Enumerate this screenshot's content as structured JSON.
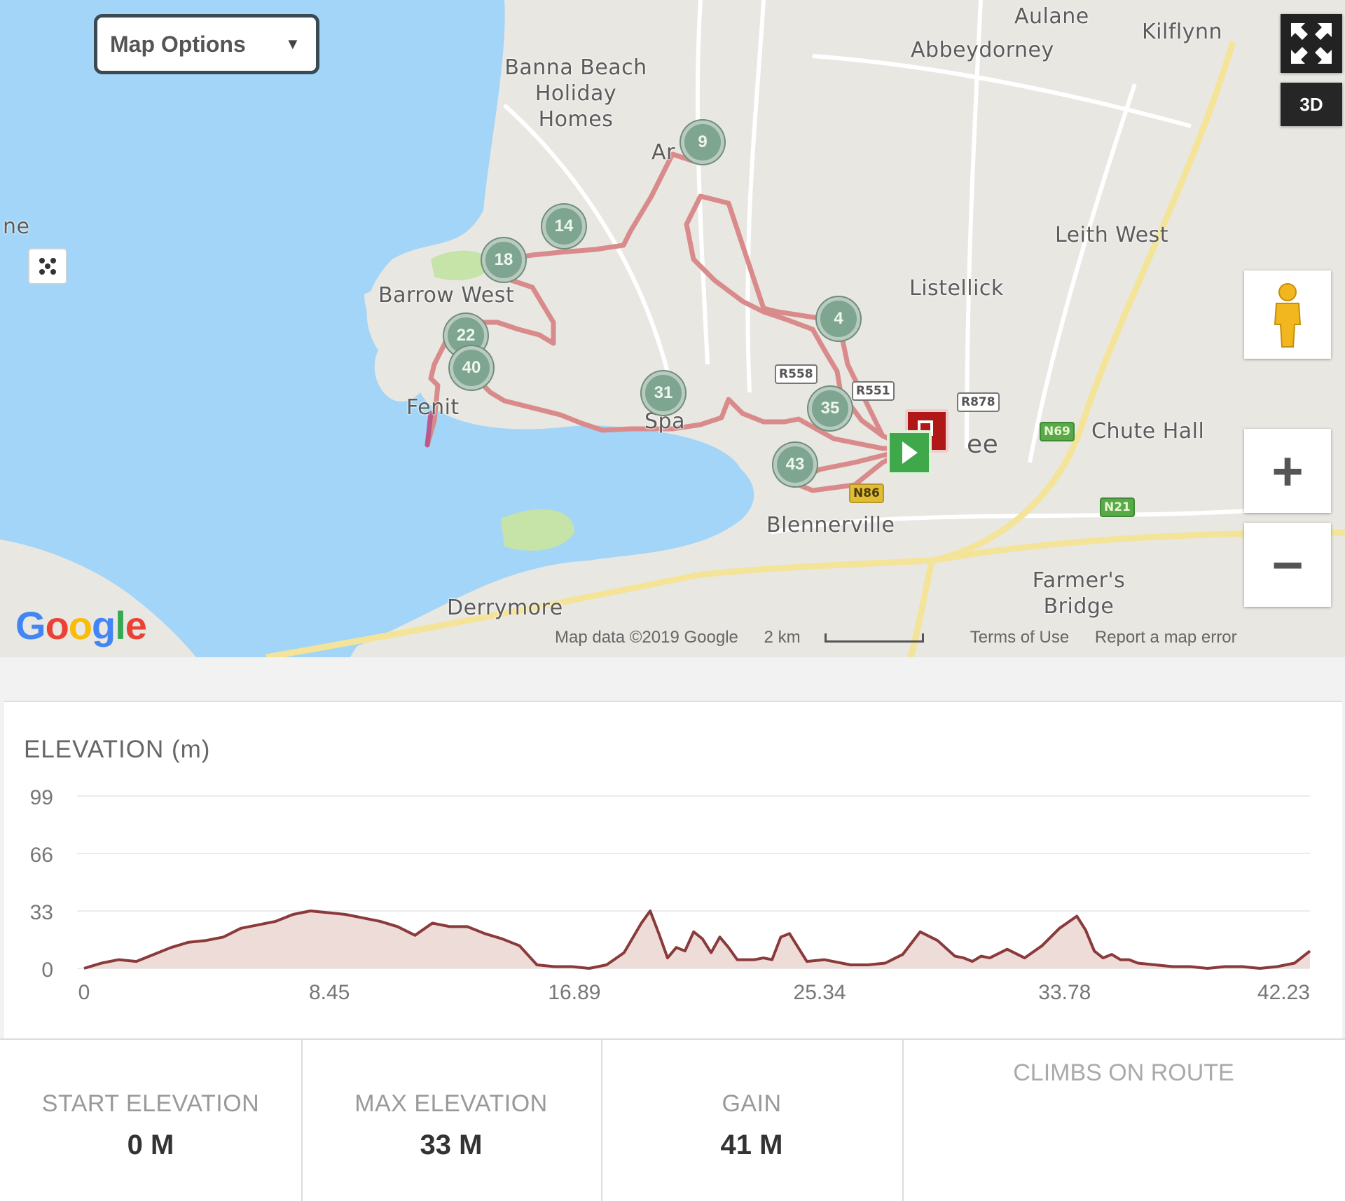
{
  "map": {
    "options_label": "Map Options",
    "view_3d_label": "3D",
    "places": [
      {
        "text": "Aulane"
      },
      {
        "text": "Kilflynn"
      },
      {
        "text": "Abbeydorney"
      },
      {
        "text": "Banna Beach Holiday Homes"
      },
      {
        "text": "Ar"
      },
      {
        "text": "Leith West"
      },
      {
        "text": "Listellick"
      },
      {
        "text": "Barrow West"
      },
      {
        "text": "Fenit"
      },
      {
        "text": "Spa"
      },
      {
        "text": "Chute Hall"
      },
      {
        "text": "Blennerville"
      },
      {
        "text": "Farmer's Bridge"
      },
      {
        "text": "Derrymore"
      },
      {
        "text": "ee"
      },
      {
        "text": "ne"
      }
    ],
    "road_badges": [
      "R558",
      "R551",
      "R878",
      "N69",
      "N21",
      "N86"
    ],
    "km_markers": [
      "9",
      "14",
      "18",
      "4",
      "22",
      "40",
      "31",
      "35",
      "43"
    ],
    "footer": {
      "map_data": "Map data ©2019 Google",
      "scale": "2 km",
      "terms": "Terms of Use",
      "report": "Report a map error"
    },
    "colors": {
      "water": "#a2d5f7",
      "land": "#e9e7e2",
      "route": "#d98b8b",
      "park": "#c6e3a8"
    }
  },
  "elevation": {
    "title": "ELEVATION (m)",
    "chart_data": {
      "type": "area",
      "title": "ELEVATION (m)",
      "xlabel": "",
      "ylabel": "",
      "ylim": [
        0,
        99
      ],
      "xlim": [
        0,
        42.23
      ],
      "y_ticks": [
        "0",
        "33",
        "66",
        "99"
      ],
      "x_ticks": [
        "0",
        "8.45",
        "16.89",
        "25.34",
        "33.78",
        "42.23"
      ],
      "grid": true,
      "x": [
        0,
        0.6,
        1.2,
        1.8,
        2.4,
        3.0,
        3.6,
        4.2,
        4.8,
        5.4,
        6.0,
        6.6,
        7.2,
        7.8,
        8.4,
        9.0,
        9.6,
        10.2,
        10.8,
        11.4,
        12.0,
        12.6,
        13.2,
        13.8,
        14.4,
        15.0,
        15.6,
        16.2,
        16.8,
        17.4,
        18.0,
        18.6,
        19.2,
        19.5,
        19.8,
        20.1,
        20.4,
        20.7,
        21.0,
        21.3,
        21.6,
        21.9,
        22.2,
        22.5,
        22.8,
        23.1,
        23.4,
        23.7,
        24.0,
        24.3,
        24.9,
        25.5,
        25.8,
        26.1,
        26.4,
        27.0,
        27.6,
        28.2,
        28.8,
        29.4,
        30.0,
        30.3,
        30.6,
        30.9,
        31.2,
        31.8,
        32.4,
        33.0,
        33.6,
        34.2,
        34.5,
        34.8,
        35.1,
        35.4,
        35.7,
        36.0,
        36.3,
        36.9,
        37.5,
        38.1,
        38.7,
        39.3,
        39.9,
        40.5,
        41.1,
        41.7,
        42.23
      ],
      "values": [
        0,
        3,
        5,
        4,
        8,
        12,
        15,
        16,
        18,
        23,
        25,
        27,
        31,
        33,
        32,
        31,
        29,
        27,
        24,
        19,
        26,
        24,
        24,
        20,
        17,
        13,
        2,
        1,
        1,
        0,
        2,
        9,
        26,
        33,
        20,
        6,
        12,
        10,
        21,
        17,
        9,
        18,
        12,
        5,
        5,
        5,
        6,
        5,
        18,
        20,
        4,
        5,
        4,
        3,
        2,
        2,
        3,
        8,
        21,
        16,
        7,
        6,
        4,
        7,
        6,
        11,
        6,
        13,
        23,
        30,
        22,
        10,
        6,
        8,
        5,
        5,
        3,
        2,
        1,
        1,
        0,
        1,
        1,
        0,
        1,
        3,
        10
      ],
      "line_color": "#8a3a3a",
      "fill_color": "#eddcd8"
    }
  },
  "stats": [
    {
      "label": "START ELEVATION",
      "value": "0 M"
    },
    {
      "label": "MAX ELEVATION",
      "value": "33 M"
    },
    {
      "label": "GAIN",
      "value": "41 M"
    }
  ],
  "climbs_label": "CLIMBS ON ROUTE"
}
